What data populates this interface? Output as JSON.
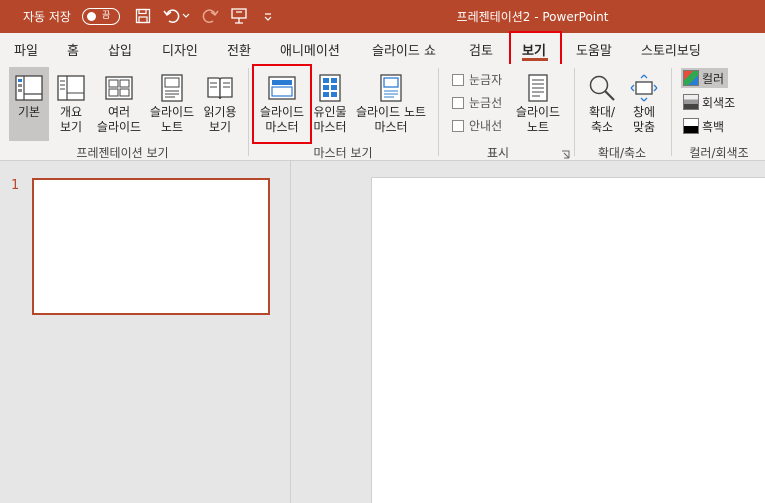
{
  "titlebar": {
    "autosave_label": "자동 저장",
    "autosave_state": "끔",
    "doc_title": "프레젠테이션2  -  PowerPoint",
    "icons": [
      "save-icon",
      "undo-icon",
      "redo-icon",
      "slideshow-icon",
      "customize-toolbar-icon"
    ]
  },
  "tabs": [
    "파일",
    "홈",
    "삽입",
    "디자인",
    "전환",
    "애니메이션",
    "슬라이드 쇼",
    "검토",
    "보기",
    "도움말",
    "스토리보딩"
  ],
  "active_tab": "보기",
  "ribbon": {
    "presentation_views": {
      "label": "프레젠테이션 보기",
      "items": [
        "기본",
        "개요\n보기",
        "여러\n슬라이드",
        "슬라이드\n노트",
        "읽기용\n보기"
      ]
    },
    "master_views": {
      "label": "마스터 보기",
      "items": [
        "슬라이드\n마스터",
        "유인물\n마스터",
        "슬라이드 노트\n마스터"
      ]
    },
    "show": {
      "label": "표시",
      "checkboxes": [
        "눈금자",
        "눈금선",
        "안내선"
      ],
      "notes_button": "슬라이드\n노트"
    },
    "zoom": {
      "label": "확대/축소",
      "items": [
        "확대/\n축소",
        "창에\n맞춤"
      ]
    },
    "color": {
      "label": "컬러/회색조",
      "options": [
        "컬러",
        "회색조",
        "흑백"
      ]
    }
  },
  "slides": {
    "thumbnail_number": "1"
  },
  "colors": {
    "accent": "#b7472a",
    "highlight": "#e8000b"
  }
}
